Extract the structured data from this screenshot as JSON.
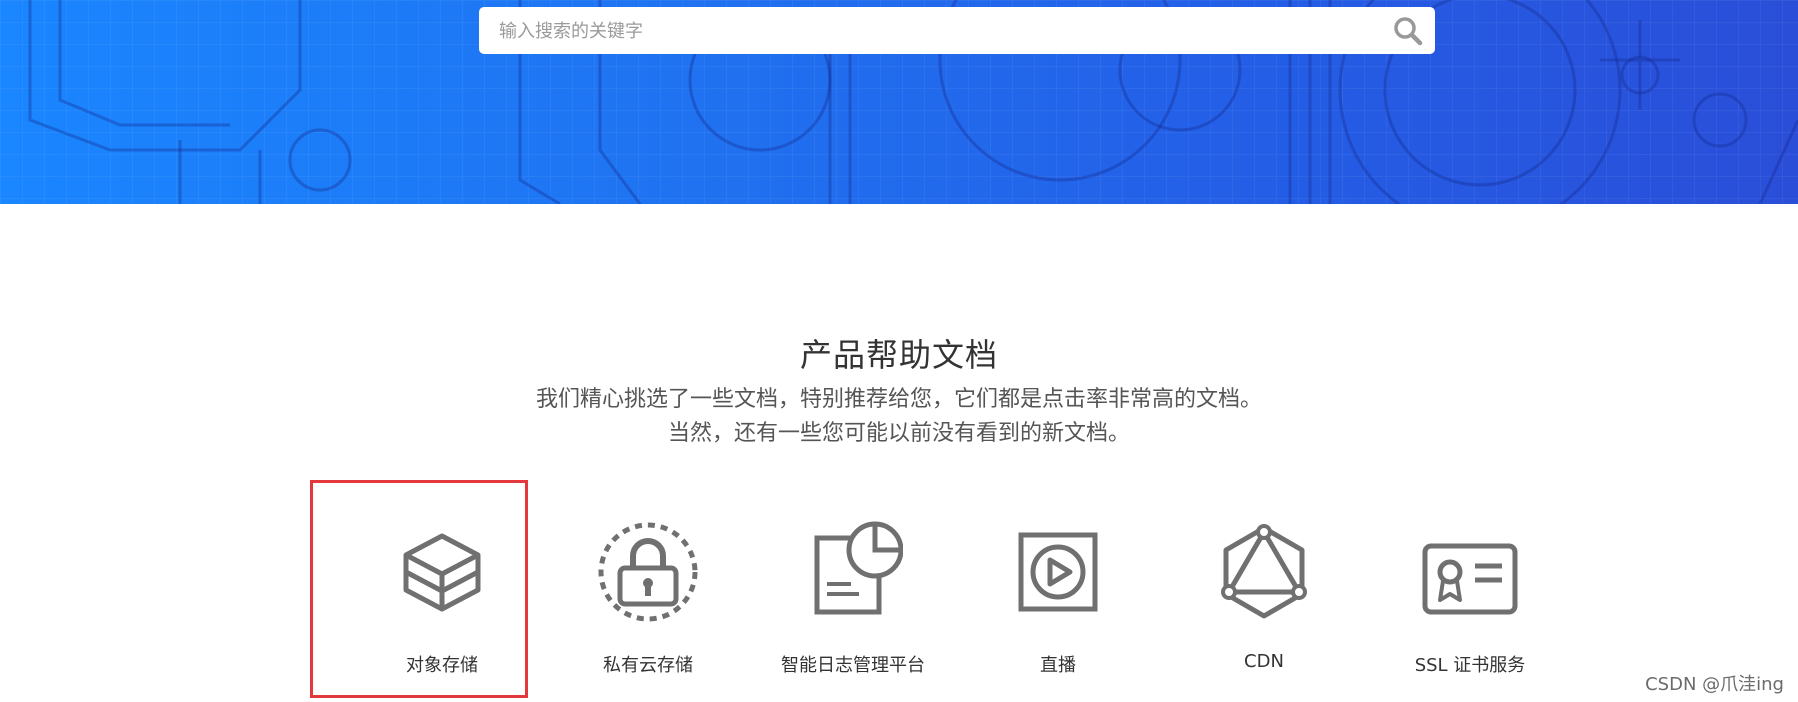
{
  "search": {
    "placeholder": "输入搜索的关键字",
    "button_icon": "search-icon"
  },
  "section": {
    "title": "产品帮助文档",
    "desc_line1": "我们精心挑选了一些文档，特别推荐给您，它们都是点击率非常高的文档。",
    "desc_line2": "当然，还有一些您可能以前没有看到的新文档。"
  },
  "products": [
    {
      "label": "对象存储",
      "icon": "layered-cube-icon",
      "selected": true
    },
    {
      "label": "私有云存储",
      "icon": "lock-icon"
    },
    {
      "label": "智能日志管理平台",
      "icon": "log-chart-icon"
    },
    {
      "label": "直播",
      "icon": "play-icon"
    },
    {
      "label": "CDN",
      "icon": "network-icon"
    },
    {
      "label": "SSL 证书服务",
      "icon": "certificate-icon"
    }
  ],
  "watermark": "CSDN @爪洼ing",
  "colors": {
    "hero_start": "#1a86ff",
    "hero_end": "#2a4ed8",
    "icon_gray": "#707070",
    "highlight": "#e4393c"
  }
}
